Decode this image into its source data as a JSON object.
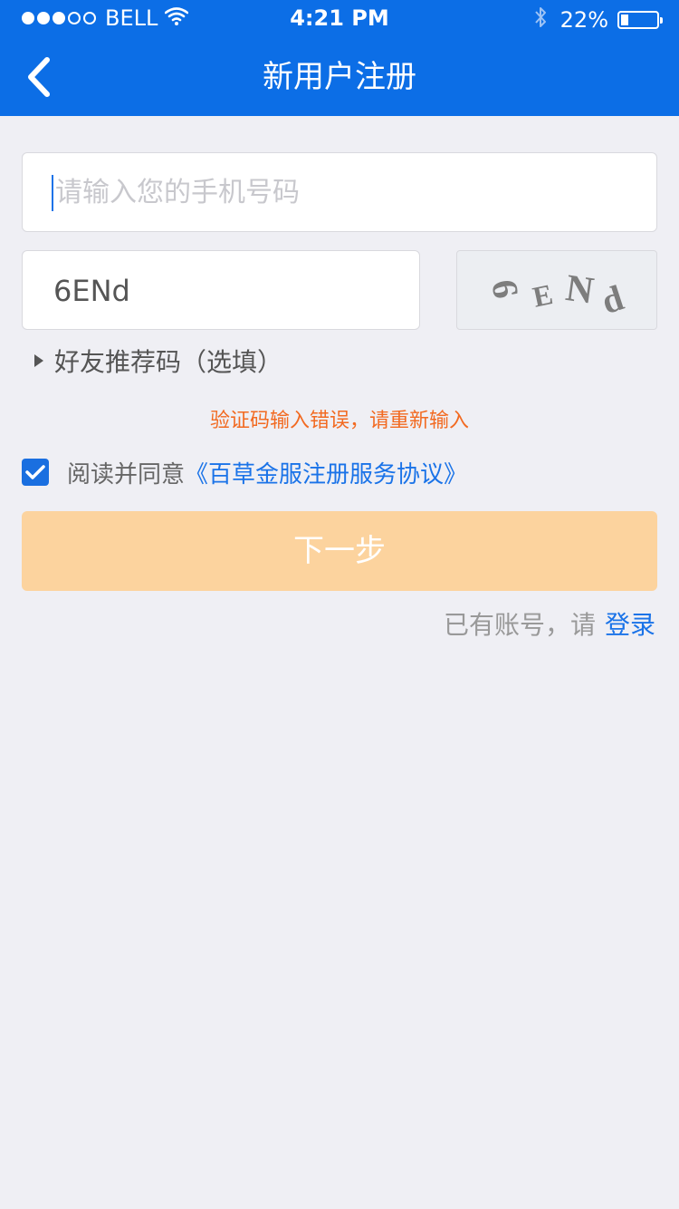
{
  "status_bar": {
    "carrier": "BELL",
    "time": "4:21 PM",
    "battery_text": "22%",
    "battery_level": 0.22
  },
  "nav": {
    "title": "新用户注册",
    "back_icon": "chevron-left-icon"
  },
  "form": {
    "phone_placeholder": "请输入您的手机号码",
    "captcha_value": "6ENd",
    "captcha_image_text": [
      "6",
      "E",
      "N",
      "d"
    ],
    "referral_label": "好友推荐码（选填）",
    "error_message": "验证码输入错误，请重新输入",
    "agreement_prefix": "阅读并同意",
    "agreement_link": "《百草金服注册服务协议》",
    "agreement_checked": true,
    "next_button": "下一步"
  },
  "footer": {
    "login_prompt": "已有账号，请",
    "login_link": "登录"
  },
  "colors": {
    "primary": "#0c6ee6",
    "link": "#1a73e8",
    "error": "#f26a21",
    "button_disabled": "#fcd39e",
    "background": "#efeff4"
  }
}
